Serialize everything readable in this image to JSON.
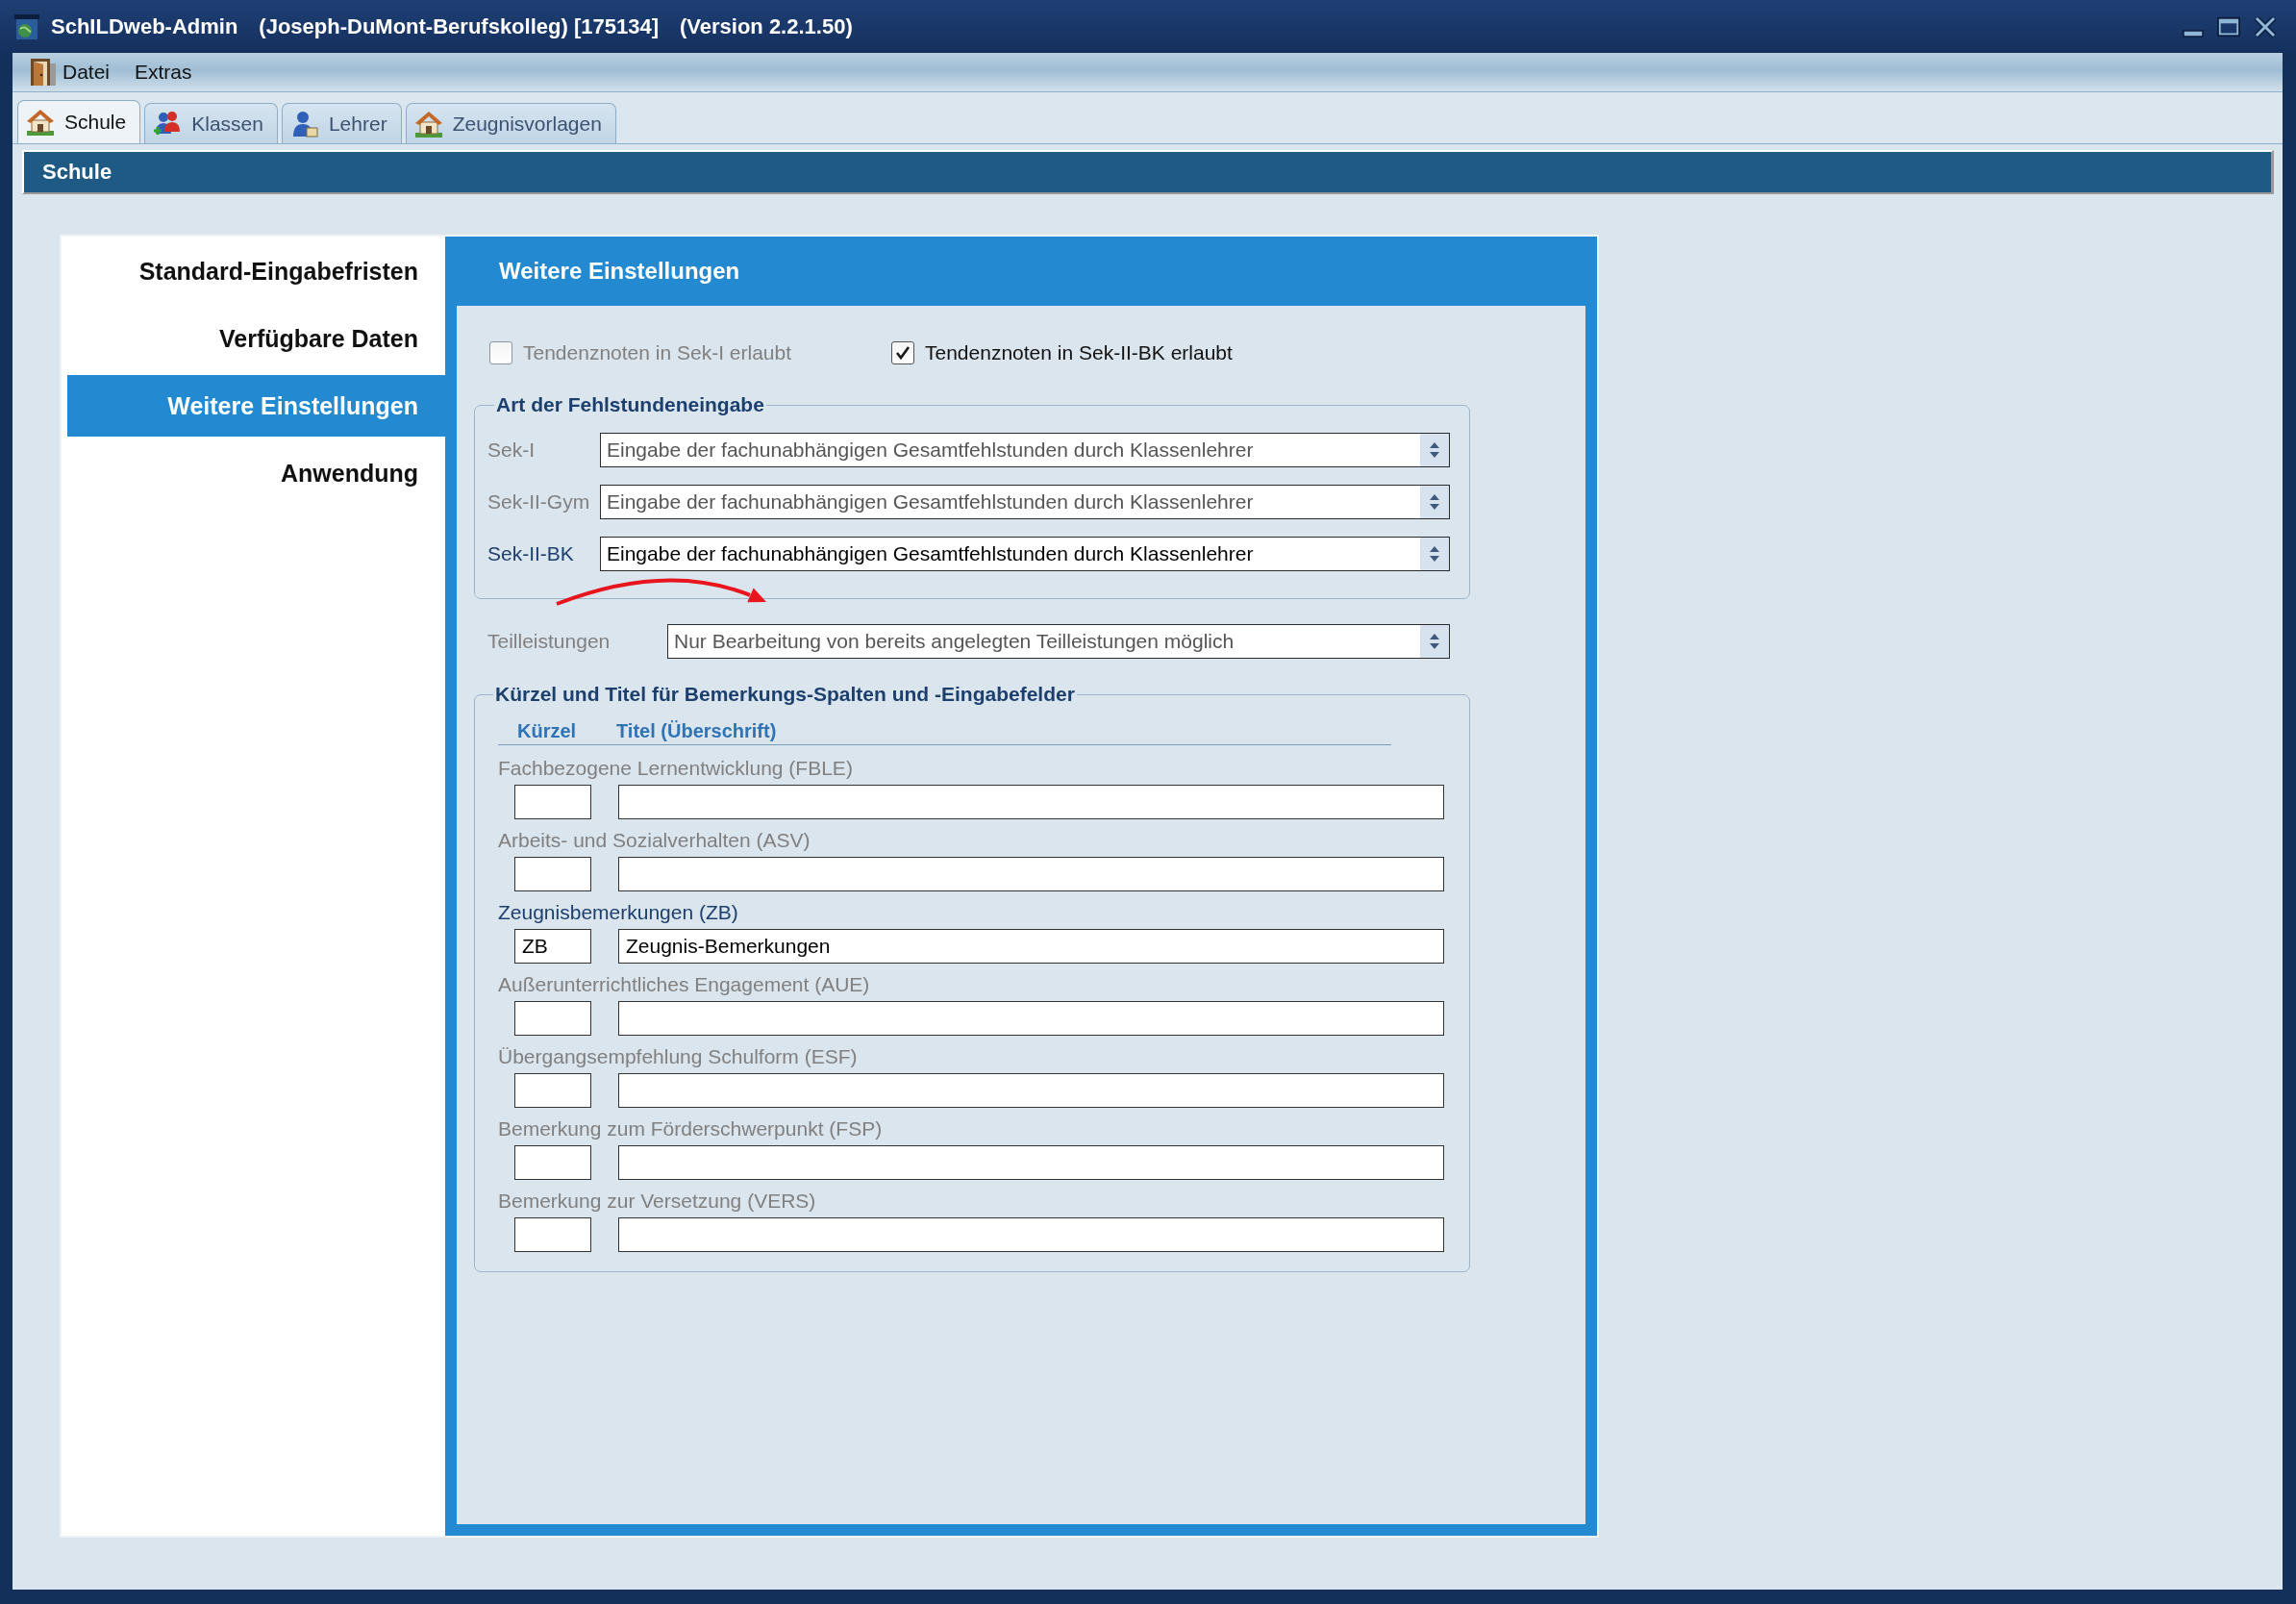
{
  "window": {
    "title_parts": [
      "SchILDweb-Admin",
      "(Joseph-DuMont-Berufskolleg) [175134]",
      "(Version 2.2.1.50)"
    ]
  },
  "menu": [
    {
      "label": "Datei",
      "kind": "icon"
    },
    {
      "label": "Extras",
      "kind": "text"
    }
  ],
  "tabs": [
    {
      "label": "Schule",
      "kind": "school",
      "selected": true
    },
    {
      "label": "Klassen",
      "kind": "classes",
      "selected": false
    },
    {
      "label": "Lehrer",
      "kind": "teachers",
      "selected": false
    },
    {
      "label": "Zeugnisvorlagen",
      "kind": "templates",
      "selected": false
    }
  ],
  "section_header": {
    "title": "Schule"
  },
  "sidebar": {
    "items": [
      {
        "label": "Standard-Eingabefristen",
        "selected": false
      },
      {
        "label": "Verfügbare Daten",
        "selected": false
      },
      {
        "label": "Weitere Einstellungen",
        "selected": true
      },
      {
        "label": "Anwendung",
        "selected": false
      }
    ]
  },
  "panel": {
    "title": "Weitere Einstellungen",
    "checkboxes": [
      {
        "label": "Tendenznoten in Sek-I erlaubt",
        "checked": false,
        "disabled": true
      },
      {
        "label": "Tendenznoten in Sek-II-BK erlaubt",
        "checked": true,
        "disabled": false
      }
    ],
    "absence_entry": {
      "legend": "Art der Fehlstundeneingabe",
      "rows": [
        {
          "label": "Sek-I",
          "value": "Eingabe der fachunabhängigen Gesamtfehlstunden durch Klassenlehrer",
          "disabled": true
        },
        {
          "label": "Sek-II-Gym",
          "value": "Eingabe der fachunabhängigen Gesamtfehlstunden durch Klassenlehrer",
          "disabled": true
        },
        {
          "label": "Sek-II-BK",
          "value": "Eingabe der fachunabhängigen Gesamtfehlstunden durch Klassenlehrer",
          "disabled": false
        }
      ]
    },
    "partial_grades": {
      "label": "Teilleistungen",
      "value": "Nur Bearbeitung von bereits angelegten Teilleistungen möglich",
      "disabled": true
    },
    "remarks": {
      "legend": "Kürzel und Titel für Bemerkungs-Spalten und -Eingabefelder",
      "columns": [
        "Kürzel",
        "Titel (Überschrift)"
      ],
      "rows": [
        {
          "label": "Fachbezogene Lernentwicklung (FBLE)",
          "disabled": true
        },
        {
          "label": "Arbeits- und Sozialverhalten (ASV)",
          "disabled": true
        },
        {
          "label": "Zeugnisbemerkungen (ZB)",
          "abbreviation": "ZB",
          "title": "Zeugnis-Bemerkungen",
          "disabled": false
        },
        {
          "label": "Außerunterrichtliches Engagement (AUE)",
          "disabled": true
        },
        {
          "label": "Übergangsempfehlung Schulform (ESF)",
          "disabled": true
        },
        {
          "label": "Bemerkung zum Förderschwerpunkt (FSP)",
          "disabled": true
        },
        {
          "label": "Bemerkung zur Versetzung (VERS)",
          "disabled": true
        }
      ]
    }
  }
}
